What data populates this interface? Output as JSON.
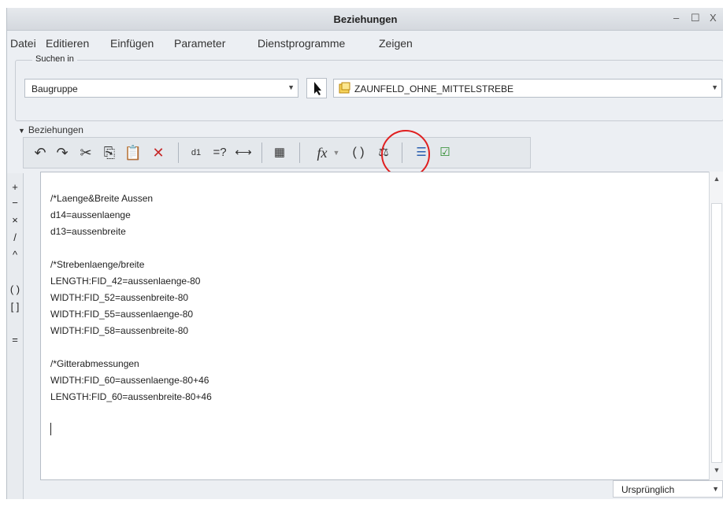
{
  "window": {
    "title": "Beziehungen",
    "controls": [
      "‒",
      "☐",
      "X"
    ]
  },
  "menu": [
    "Datei",
    "Editieren",
    "Einfügen",
    "Parameter",
    "Dienstprogramme",
    "Zeigen"
  ],
  "search": {
    "group_label": "Suchen in",
    "scope_value": "Baugruppe",
    "model_value": "ZAUNFELD_OHNE_MITTELSTREBE"
  },
  "relations": {
    "section_label": "Beziehungen",
    "toolbar_icons": [
      "undo-icon",
      "redo-icon",
      "cut-icon",
      "copy-icon",
      "paste-icon",
      "delete-icon",
      "display-values-icon",
      "evaluate-icon",
      "measure-icon",
      "local-parameters-icon",
      "insert-function-icon",
      "insert-parameter-icon",
      "unit-icon",
      "sort-icon",
      "verify-icon"
    ],
    "lines": [
      "/*Laenge&Breite Aussen",
      "d14=aussenlaenge",
      "d13=aussenbreite",
      "",
      "/*Strebenlaenge/breite",
      "LENGTH:FID_42=aussenlaenge-80",
      "WIDTH:FID_52=aussenbreite-80",
      "WIDTH:FID_55=aussenlaenge-80",
      "WIDTH:FID_58=aussenbreite-80",
      "",
      "/*Gitterabmessungen",
      "WIDTH:FID_60=aussenlaenge-80+46",
      "LENGTH:FID_60=aussenbreite-80+46"
    ],
    "sidebar_ops": [
      "+",
      "−",
      "×",
      "/",
      "^",
      "( )",
      "[ ]",
      "="
    ]
  },
  "status": {
    "units_value": "Ursprünglich"
  },
  "colors": {
    "highlight_circle": "#e02020",
    "accent": "#2a7ae4"
  }
}
